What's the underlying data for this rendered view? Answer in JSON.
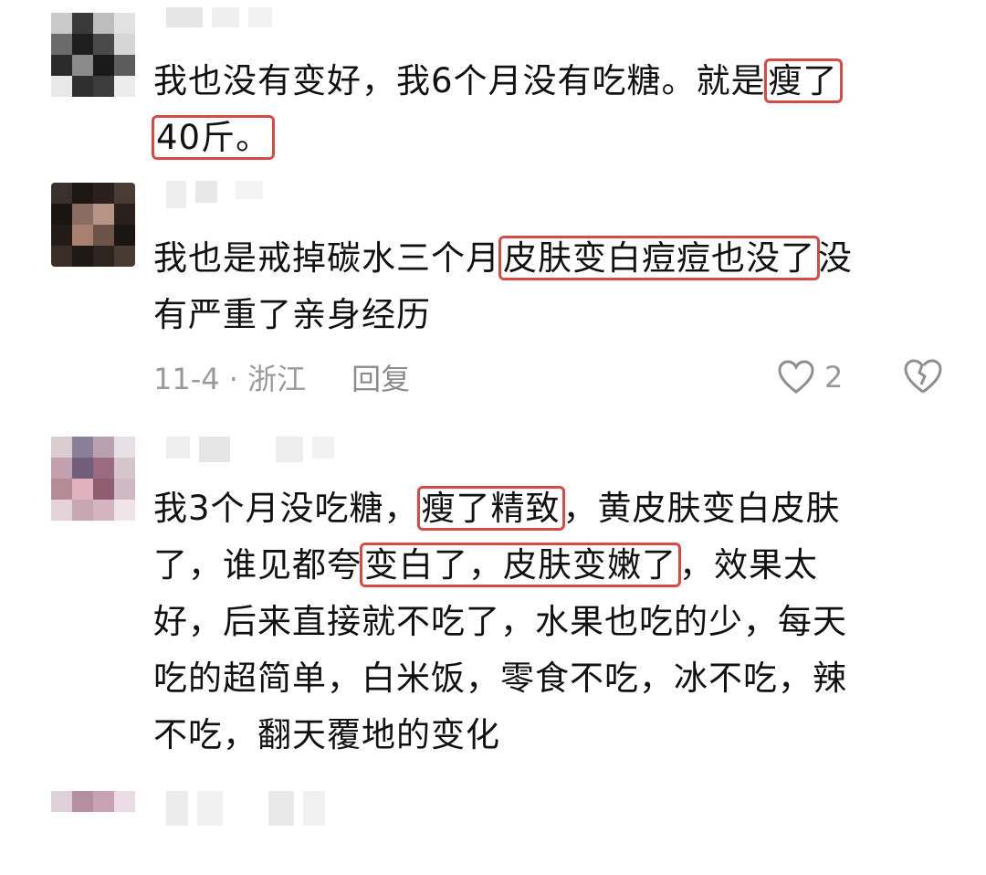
{
  "comments": [
    {
      "text_parts": [
        {
          "text": "我也没有变好，我6个月没有吃糖。就是",
          "highlight": false
        },
        {
          "text": "瘦了\n40斤。",
          "highlight": true
        }
      ],
      "line1_plain": "我也没有变好，我6个月没有吃糖。就是",
      "line1_hl": "瘦了",
      "line2_hl": "40斤。"
    },
    {
      "line1_plain": "我也是戒掉碳水三个月",
      "line1_hl": "皮肤变白痘痘也没了",
      "line1_tail": "没",
      "line2": "有严重了亲身经历",
      "date": "11-4 · 浙江",
      "reply": "回复",
      "likes": "2"
    },
    {
      "line1_plain": "我3个月没吃糖，",
      "line1_hl": "瘦了精致",
      "line1_tail": "，黄皮肤变白皮肤",
      "line2_plain": "了，谁见都夸",
      "line2_hl": "变白了，皮肤变嫩了",
      "line2_tail": "，效果太",
      "line3": "好，后来直接就不吃了，水果也吃的少，每天",
      "line4": "吃的超简单，白米饭，零食不吃，冰不吃，辣",
      "line5": "不吃，翻天覆地的变化"
    }
  ],
  "icons": {
    "like": "heart-outline-icon",
    "dislike": "broken-heart-icon"
  },
  "colors": {
    "highlight_border": "#d64b45",
    "meta_text": "#9a9a9a"
  }
}
